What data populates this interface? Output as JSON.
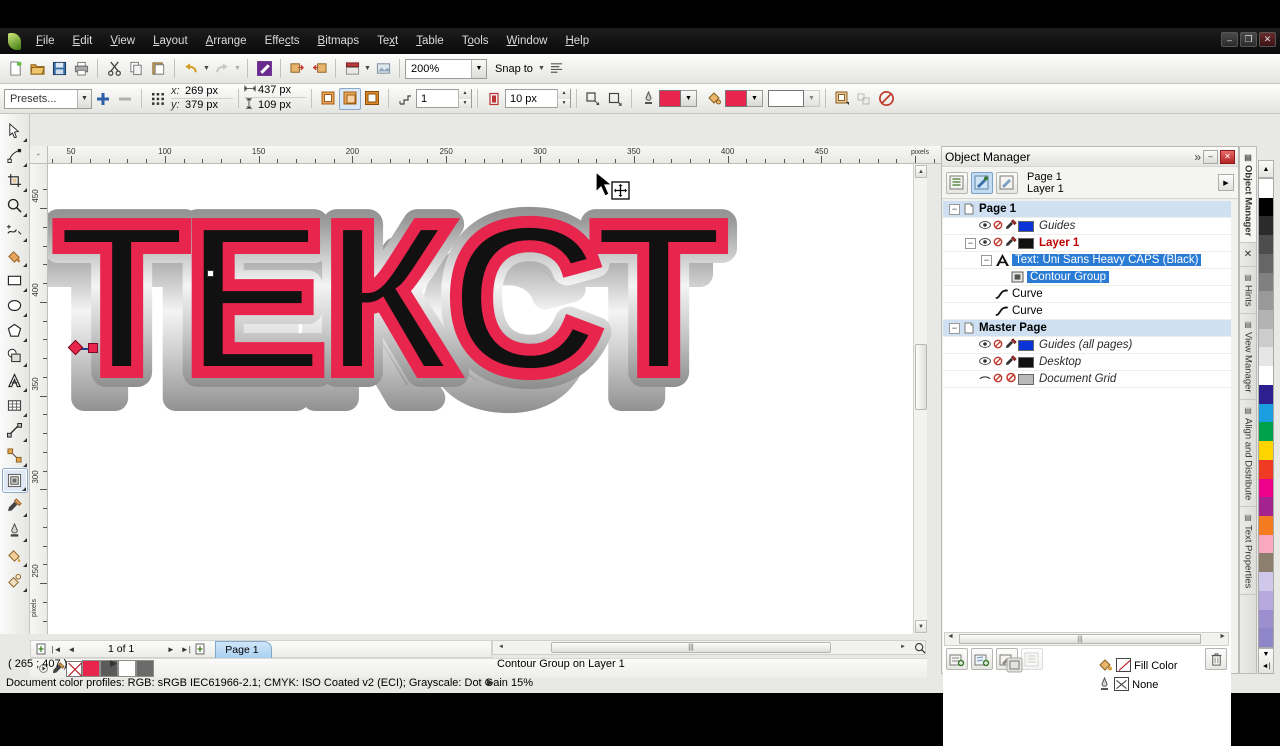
{
  "app": {
    "title": "CorelDRAW"
  },
  "menu": {
    "items": [
      {
        "label": "File",
        "accel": "F"
      },
      {
        "label": "Edit",
        "accel": "E"
      },
      {
        "label": "View",
        "accel": "V"
      },
      {
        "label": "Layout",
        "accel": "L"
      },
      {
        "label": "Arrange",
        "accel": "A"
      },
      {
        "label": "Effects",
        "accel": "c"
      },
      {
        "label": "Bitmaps",
        "accel": "B"
      },
      {
        "label": "Text",
        "accel": "x"
      },
      {
        "label": "Table",
        "accel": "T"
      },
      {
        "label": "Tools",
        "accel": "o"
      },
      {
        "label": "Window",
        "accel": "W"
      },
      {
        "label": "Help",
        "accel": "H"
      }
    ]
  },
  "window_controls": {
    "minimize": "–",
    "restore": "❐",
    "close": "✕"
  },
  "standard_toolbar": {
    "buttons": [
      "new-icon",
      "open-icon",
      "save-icon",
      "print-icon",
      "cut-icon",
      "copy-icon",
      "paste-icon",
      "undo-icon",
      "redo-icon",
      "import-icon",
      "export-icon",
      "publish-pdf-icon",
      "application-launcher-icon"
    ],
    "zoom_level": "200%",
    "snap_label": "Snap to",
    "options_icon": "options-icon"
  },
  "property_bar": {
    "presets_label": "Presets...",
    "add_preset_icon": "plus-icon",
    "remove_preset_icon": "minus-icon",
    "anchor_icon": "object-anchor-icon",
    "x_label": "x:",
    "x_value": "269 px",
    "y_label": "y:",
    "y_value": "379 px",
    "width_icon": "width-icon",
    "width_value": "437 px",
    "height_icon": "height-icon",
    "height_value": "109 px",
    "contour_inside_icon": "contour-to-center-icon",
    "contour_outside_icon": "contour-inside-icon",
    "contour_outward_icon": "contour-outside-icon",
    "steps_icon": "contour-steps-icon",
    "steps_value": "1",
    "offset_icon": "contour-offset-icon",
    "offset_value": "10 px",
    "corners_icon": "contour-corners-icon",
    "acceleration_icon": "object-acceleration-icon",
    "outline_color_icon": "outline-color-icon",
    "outline_color": "#e8254d",
    "fill_color_icon": "fill-color-icon",
    "fill_color": "#e8254d",
    "fountain_fill_color": "#ffffff",
    "copy_properties_icon": "copy-contour-properties-icon",
    "object_properties_icon": "wrap-paragraph-text-icon",
    "clear_contour_icon": "clear-contour-icon"
  },
  "toolbox": {
    "tools": [
      {
        "name": "pick-tool",
        "icon": "arrow"
      },
      {
        "name": "shape-tool",
        "icon": "node-edit"
      },
      {
        "name": "crop-tool",
        "icon": "crop"
      },
      {
        "name": "zoom-tool",
        "icon": "magnifier"
      },
      {
        "name": "freehand-tool",
        "icon": "curve"
      },
      {
        "name": "smart-fill-tool",
        "icon": "smart-fill"
      },
      {
        "name": "rectangle-tool",
        "icon": "rectangle"
      },
      {
        "name": "ellipse-tool",
        "icon": "ellipse"
      },
      {
        "name": "polygon-tool",
        "icon": "polygon"
      },
      {
        "name": "basic-shapes-tool",
        "icon": "shapes"
      },
      {
        "name": "text-tool",
        "icon": "letter-a"
      },
      {
        "name": "table-tool",
        "icon": "table"
      },
      {
        "name": "parallel-dimension-tool",
        "icon": "dimension"
      },
      {
        "name": "straight-line-connector-tool",
        "icon": "connector"
      },
      {
        "name": "blend-tool",
        "icon": "contour",
        "selected": true
      },
      {
        "name": "color-eyedropper-tool",
        "icon": "eyedropper"
      },
      {
        "name": "outline-tool",
        "icon": "pen-nib"
      },
      {
        "name": "fill-tool",
        "icon": "paint-bucket"
      },
      {
        "name": "interactive-fill-tool",
        "icon": "interactive-fill"
      }
    ]
  },
  "rulers": {
    "unit_label": "pixels",
    "horizontal_ticks": [
      "50",
      "100",
      "150",
      "200",
      "250",
      "300",
      "350",
      "400",
      "450"
    ],
    "vertical_ticks": [
      "450",
      "400",
      "350",
      "300",
      "250"
    ]
  },
  "artwork": {
    "text": "ТЕКСТ",
    "font": "Uni Sans Heavy CAPS",
    "face_color": "#111111",
    "contour_color": "#e8254d",
    "extrude_light": "#f2f2f2",
    "extrude_dark": "#6b6b6b",
    "extrude_mid": "#8f8f8f"
  },
  "page_navigator": {
    "first_icon": "first-page-icon",
    "prev_icon": "previous-page-icon",
    "counter": "1 of 1",
    "next_icon": "next-page-icon",
    "last_icon": "last-page-icon",
    "add_page_icon": "add-page-icon",
    "tab_label": "Page 1"
  },
  "docker": {
    "title": "Object Manager",
    "collapse_icon": "»",
    "minimize_icon": "–",
    "close_icon": "✕",
    "tool_buttons": [
      {
        "name": "show-object-properties",
        "on": false
      },
      {
        "name": "edit-across-layers",
        "on": true
      },
      {
        "name": "layer-manager-view",
        "on": false
      }
    ],
    "page_label": "Page 1",
    "layer_label": "Layer 1",
    "more_icon": "▶",
    "tree": [
      {
        "indent": 0,
        "expander": "−",
        "type": "page",
        "label": "Page 1",
        "style": "bold",
        "header": true
      },
      {
        "indent": 1,
        "expander": "",
        "type": "layer",
        "label": "Guides",
        "style": "italic",
        "color": "#0a33d8"
      },
      {
        "indent": 1,
        "expander": "−",
        "type": "layer",
        "label": "Layer 1",
        "style": "red",
        "color": "#111111"
      },
      {
        "indent": 2,
        "expander": "−",
        "type": "text",
        "label": "Text: Uni Sans Heavy CAPS (Black)",
        "style": "sel"
      },
      {
        "indent": 3,
        "expander": "",
        "type": "group",
        "label": "Contour Group",
        "style": "sel"
      },
      {
        "indent": 2,
        "expander": "",
        "type": "curve",
        "label": "Curve",
        "style": "plain"
      },
      {
        "indent": 2,
        "expander": "",
        "type": "curve",
        "label": "Curve",
        "style": "plain"
      },
      {
        "indent": 0,
        "expander": "−",
        "type": "page",
        "label": "Master Page",
        "style": "bold",
        "header": true
      },
      {
        "indent": 1,
        "expander": "",
        "type": "layer",
        "label": "Guides (all pages)",
        "style": "italic",
        "color": "#0a33d8"
      },
      {
        "indent": 1,
        "expander": "",
        "type": "layer",
        "label": "Desktop",
        "style": "italic",
        "color": "#111111"
      },
      {
        "indent": 1,
        "expander": "",
        "type": "layer",
        "label": "Document Grid",
        "style": "italic",
        "color": "#b9b9b9"
      }
    ],
    "bottom_buttons": [
      "new-layer-icon",
      "new-master-layer-icon",
      "new-object-icon",
      "layer-properties-icon"
    ],
    "delete_icon": "trash-icon"
  },
  "docker_tabs": [
    {
      "label": "Object Manager",
      "icon": "object-manager-icon",
      "active": true
    },
    {
      "label": "Hints",
      "icon": "hints-icon",
      "active": false
    },
    {
      "label": "View Manager",
      "icon": "view-manager-icon",
      "active": false
    },
    {
      "label": "Align and Distribute",
      "icon": "align-icon",
      "active": false
    },
    {
      "label": "Text Properties",
      "icon": "text-properties-icon",
      "active": false
    }
  ],
  "status_bar": {
    "coordinates": "( 265  ; 407  )",
    "selection_info": "Contour Group on Layer 1",
    "color_profiles": "Document color profiles: RGB: sRGB IEC61966-2.1; CMYK: ISO Coated v2 (ECI); Grayscale: Dot Gain 15%",
    "fill_label": "Fill Color",
    "outline_label": "None"
  },
  "color_palette": [
    "#ffffff",
    "#000000",
    "#2b2b2b",
    "#4d4d4d",
    "#666666",
    "#808080",
    "#999999",
    "#b3b3b3",
    "#cccccc",
    "#e6e6e6",
    "#ffffff",
    "#2e1f8f",
    "#1a9ee0",
    "#00a14b",
    "#ffd400",
    "#ef3a24",
    "#ec008c",
    "#a3248f",
    "#f47b20",
    "#f9a8c0",
    "#8c7f6e",
    "#cfc8ea",
    "#b7a9dd",
    "#9b8fd0",
    "#8f86c9"
  ],
  "bottom_swatches": [
    "#e8254d",
    "#5b5b5b",
    "#ffffff",
    "#6b6b6b"
  ]
}
